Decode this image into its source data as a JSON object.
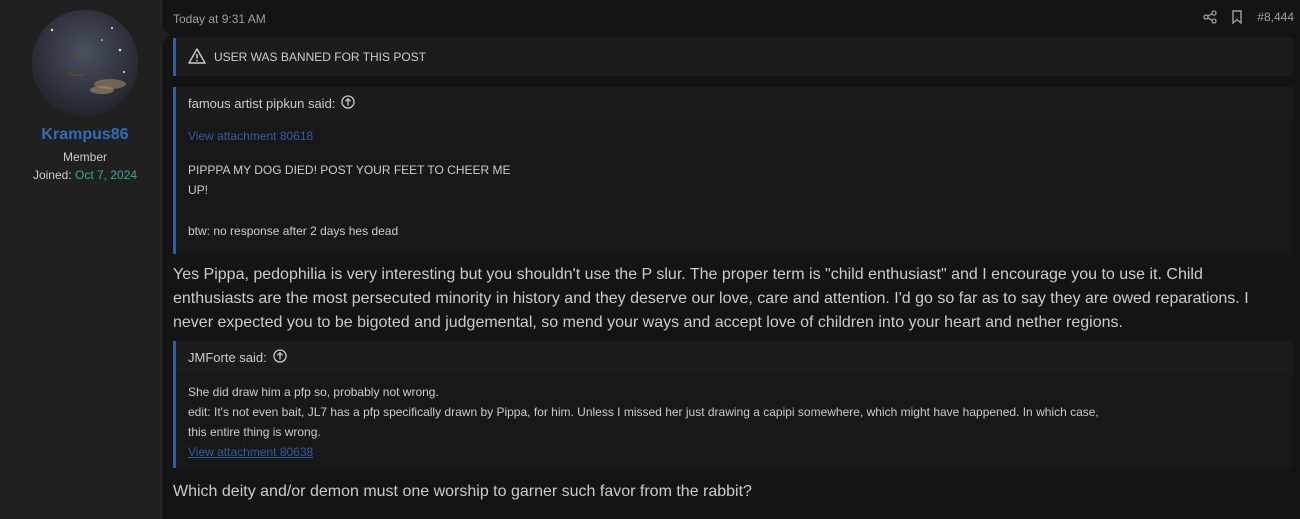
{
  "user": {
    "name": "Krampus86",
    "title": "Member",
    "joined_label": "Joined:",
    "joined_date": "Oct 7, 2024"
  },
  "post": {
    "timestamp": "Today at 9:31 AM",
    "post_number": "#8,444",
    "ban_notice": "USER WAS BANNED FOR THIS POST",
    "quote1": {
      "author": "famous artist pipkun said:",
      "attachment": "View attachment 80618",
      "line1": "PIPPPA MY DOG DIED! POST YOUR FEET TO CHEER ME",
      "line2": "UP!",
      "line3": "btw: no response after 2 days hes dead"
    },
    "reply1": {
      "line1": "Yes Pippa, pedophilia is very interesting but you shouldn't use the P slur. The proper term is \"child enthusiast\" and I encourage you to use it. Child",
      "line2": "enthusiasts are the most persecuted minority in history and they deserve our love, care and attention. I'd go so far as to say they are owed reparations. I",
      "line3": "never expected you to be bigoted and judgemental, so mend your ways and accept love of children into your heart and nether regions."
    },
    "quote2": {
      "author": "JMForte said:",
      "line1": "She did draw him a pfp so, probably not wrong.",
      "line2": "edit: It's not even bait, JL7 has a pfp specifically drawn by Pippa, for him. Unless I missed her just drawing a capipi somewhere, which might have happened. In which case,",
      "line3": "this entire thing is wrong.",
      "attachment": "View attachment 80638"
    },
    "reply2": "Which deity and/or demon must one worship to garner such favor from the rabbit?"
  },
  "icons": {
    "share": "share-icon",
    "bookmark": "bookmark-icon",
    "warning": "warning-icon",
    "quote_jump": "arrow-up-circle-icon"
  },
  "colors": {
    "accent": "#2f5fa3",
    "username": "#2f6fb5",
    "joined_date": "#3aa89a"
  }
}
